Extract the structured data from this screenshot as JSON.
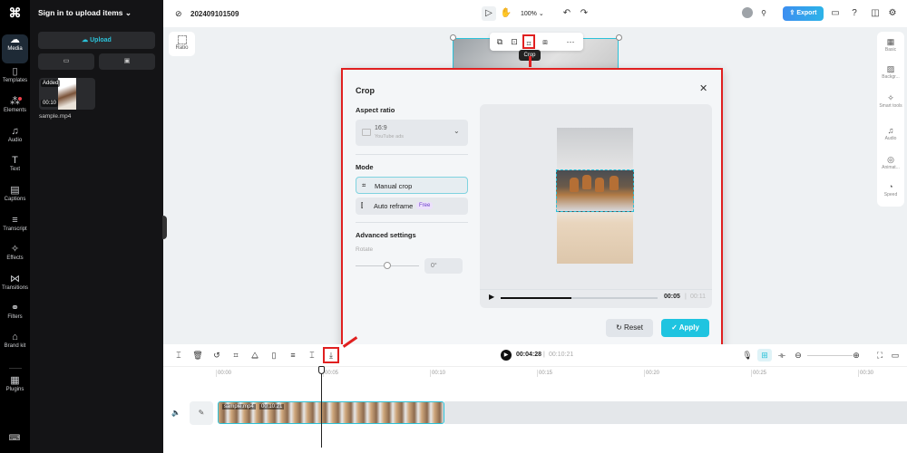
{
  "app": {
    "project_name": "202409101509",
    "zoom_level": "100%",
    "export_label": "Export"
  },
  "rail": {
    "items": [
      {
        "label": "Media",
        "icon": "cloud-upload-icon",
        "active": true
      },
      {
        "label": "Templates",
        "icon": "template-icon"
      },
      {
        "label": "Elements",
        "icon": "elements-icon",
        "badge": true
      },
      {
        "label": "Audio",
        "icon": "music-icon"
      },
      {
        "label": "Text",
        "icon": "text-icon"
      },
      {
        "label": "Captions",
        "icon": "captions-icon"
      },
      {
        "label": "Transcript",
        "icon": "transcript-icon"
      },
      {
        "label": "Effects",
        "icon": "effects-icon"
      },
      {
        "label": "Transitions",
        "icon": "transitions-icon"
      },
      {
        "label": "Filters",
        "icon": "filters-icon"
      },
      {
        "label": "Brand kit",
        "icon": "brand-kit-icon"
      },
      {
        "label": "Plugins",
        "icon": "plugins-icon"
      }
    ]
  },
  "panel": {
    "title": "Sign in to upload items",
    "upload_label": "Upload",
    "media": [
      {
        "name": "sample.mp4",
        "status": "Added",
        "duration": "00:10"
      }
    ]
  },
  "canvas": {
    "ratio_label": "Ratio",
    "tooltip": "Crop"
  },
  "right_sidebar": {
    "items": [
      {
        "label": "Basic"
      },
      {
        "label": "Backgr..."
      },
      {
        "label": "Smart tools"
      },
      {
        "label": "Audio"
      },
      {
        "label": "Animat..."
      },
      {
        "label": "Speed"
      }
    ]
  },
  "crop_dialog": {
    "title": "Crop",
    "aspect_ratio_label": "Aspect ratio",
    "aspect_value": "16:9",
    "aspect_sub": "YouTube ads",
    "mode_label": "Mode",
    "modes": [
      {
        "label": "Manual crop",
        "selected": true
      },
      {
        "label": "Auto reframe",
        "badge": "Free"
      }
    ],
    "advanced_label": "Advanced settings",
    "rotate_label": "Rotate",
    "rotate_value": "0°",
    "rotate_fraction": 0.5,
    "playback": {
      "current": "00:05",
      "total": "00:11",
      "progress": 0.45
    },
    "reset_label": "Reset",
    "apply_label": "Apply"
  },
  "timeline": {
    "current_time": "00:04:28",
    "total_time": "00:10:21",
    "ruler_ticks": [
      "00:00",
      "00:05",
      "00:10",
      "00:15",
      "00:20",
      "00:25",
      "00:30"
    ],
    "clip": {
      "name": "sample.mp4",
      "duration": "00:10:21"
    }
  }
}
